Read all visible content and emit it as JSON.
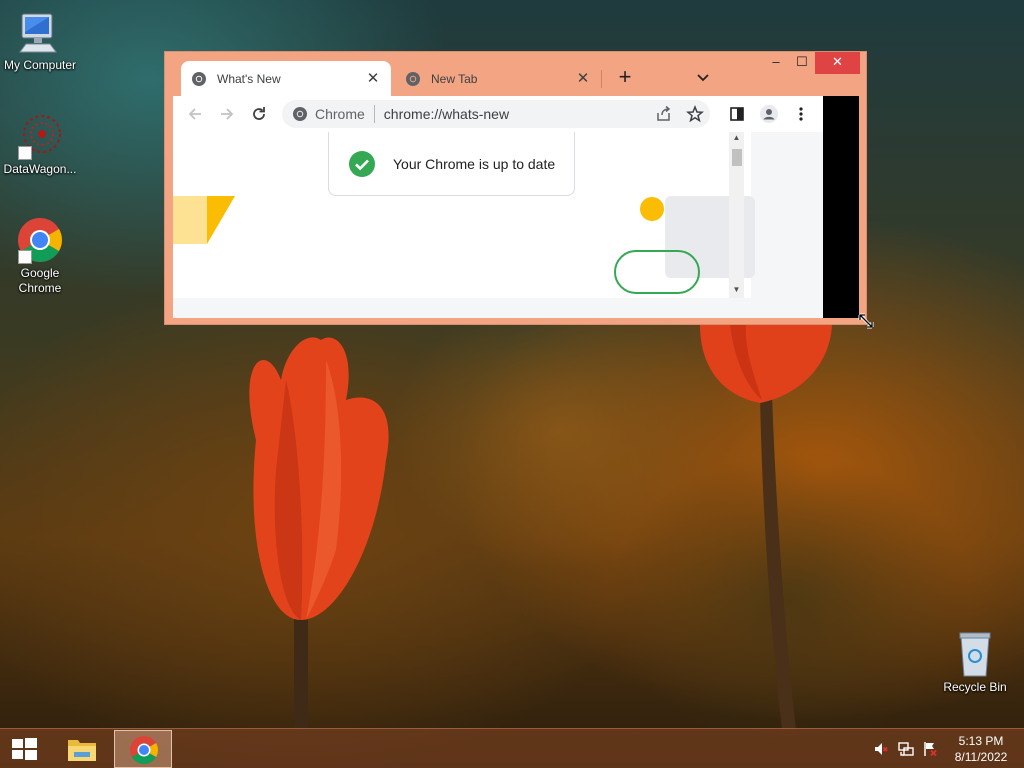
{
  "desktop": {
    "icons": [
      {
        "label": "My Computer",
        "icon": "computer-icon"
      },
      {
        "label": "DataWagon...",
        "icon": "datawagon-icon"
      },
      {
        "label": "Google Chrome",
        "icon": "chrome-icon"
      },
      {
        "label": "Recycle Bin",
        "icon": "recycle-bin-icon"
      }
    ]
  },
  "browser": {
    "tabs": [
      {
        "title": "What's New",
        "icon": "chrome-favicon",
        "active": true
      },
      {
        "title": "New Tab",
        "icon": "chrome-favicon",
        "active": false
      }
    ],
    "new_tab_symbol": "+",
    "tab_search_symbol": "⌄",
    "window_controls": {
      "minimize": "–",
      "maximize": "☐",
      "close": "✕"
    },
    "omnibox": {
      "chip_label": "Chrome",
      "url": "chrome://whats-new"
    },
    "page": {
      "update_message": "Your Chrome is up to date"
    }
  },
  "taskbar": {
    "clock": {
      "time": "5:13 PM",
      "date": "8/11/2022"
    }
  },
  "colors": {
    "window_frame": "#f3a583",
    "close_button": "#e04343",
    "check_green": "#34a853",
    "accent_yellow": "#fbbc04"
  }
}
